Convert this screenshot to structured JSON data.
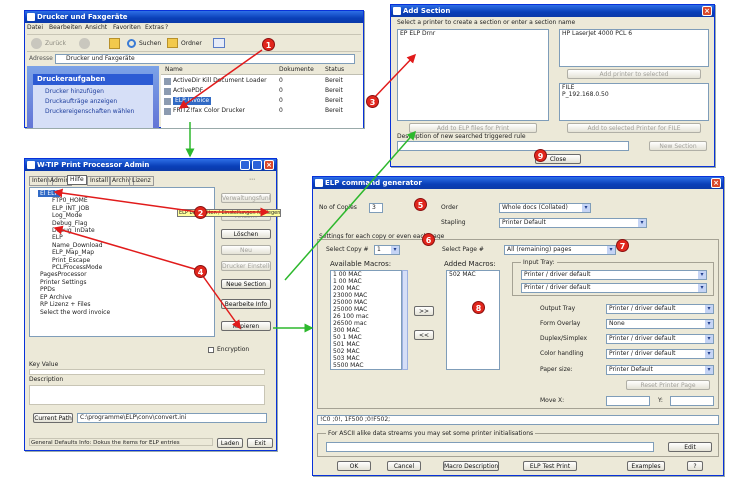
{
  "explorer": {
    "title": "Drucker und Faxgeräte",
    "menu": [
      "Datei",
      "Bearbeiten",
      "Ansicht",
      "Favoriten",
      "Extras",
      "?"
    ],
    "toolbar": {
      "back": "Zurück",
      "search": "Suchen",
      "folders": "Ordner"
    },
    "address_label": "Adresse",
    "address_value": "Drucker und Faxgeräte",
    "tasks_header": "Druckeraufgaben",
    "tasks": [
      "Drucker hinzufügen",
      "Druckaufträge anzeigen",
      "Druckereigenschaften wählen"
    ],
    "columns": [
      "Name",
      "Dokumente",
      "Status"
    ],
    "printers": [
      {
        "name": "ActiveDir Kill Document Loader",
        "docs": "0",
        "status": "Bereit"
      },
      {
        "name": "ActivePDF",
        "docs": "0",
        "status": "Bereit"
      },
      {
        "name": "ELP Invoice",
        "docs": "0",
        "status": "Bereit"
      },
      {
        "name": "FRITZ!fax Color Drucker",
        "docs": "0",
        "status": "Bereit"
      }
    ]
  },
  "admin": {
    "title": "W-TIP Print Processor Admin",
    "tabs": [
      "Intern",
      "Admin",
      "Hilfe",
      "Install",
      "Archiv",
      "Lizenz"
    ],
    "tree": [
      "El ELP",
      "FTP0_HOME",
      "ELP_INT_JOB",
      "Log_Mode",
      "Debug_Flag",
      "Debug_InDate",
      "ELP",
      "Name_Download",
      "ELP_Map_Map",
      "Print_Escape",
      "PCLProcessMode",
      "PagesProcessor",
      "Printer Settings",
      "PPDs",
      "EP Archive",
      "RP Lizenz + Files",
      "Select the word invoice"
    ],
    "tooltip": "ELP bearbeiten / Einstellungen festlegen",
    "right_buttons": [
      "Verwaltungsfunktion",
      "Ändern",
      "Löschen",
      "Neu",
      "Drucker Einstellungen",
      "Neue Section",
      "Bearbeite Info",
      "Kopieren"
    ],
    "checkbox_label": "Encryption",
    "keyvalue_label": "Key Value",
    "desc_label": "Description",
    "path_btn": "Current Path",
    "path_value": "C:\\programme\\ELP\\conv\\convert.ini",
    "status_text": "General Defaults Info: Dokus the items for ELP entries",
    "footer": [
      "Laden",
      "Exit"
    ]
  },
  "addsection": {
    "title": "Add Section",
    "instruction": "Select a printer to create a section or enter a section name",
    "left_item": "EP ELP Drnr",
    "printer_item": "HP LaserJet 4000 PCL 6",
    "add_printer_btn": "Add printer to selected",
    "file_label": "FILE",
    "file_value": "P_192.168.0.50",
    "left_btn": "Add to ELP files for Print",
    "right_btn": "Add to selected Printer for FILE",
    "desc_label": "Description of new searched triggered rule",
    "new_section_btn": "New Section",
    "close_btn": "Close"
  },
  "generator": {
    "title": "ELP command generator",
    "copies_label": "No of Copies",
    "copies_value": "3",
    "order_label": "Order",
    "order_value": "Whole docs (Collated)",
    "stapling_label": "Stapling",
    "stapling_value": "Printer Default",
    "settings_label": "Settings for each copy or even each page",
    "select_copy_label": "Select Copy #",
    "select_copy_value": "1",
    "select_page_label": "Select Page #",
    "select_page_value": "All (remaining) pages",
    "available_label": "Available Macros:",
    "added_label": "Added Macros:",
    "macros": [
      "1 00 MAC",
      "1 00 MAC",
      "200 MAC",
      "23000 MAC",
      "25000 MAC",
      "25000 MAC",
      "26 100 mac",
      "26500 mac",
      "300 MAC",
      "50 1 MAC",
      "501 MAC",
      "502 MAC",
      "503 MAC",
      "5500 MAC",
      "5510 mac"
    ],
    "added": [
      "502 MAC"
    ],
    "move_right": ">>",
    "move_left": "<<",
    "input_tray_label": "Input Tray:",
    "input_tray": [
      "Printer / driver default",
      "Printer / driver default"
    ],
    "output_tray_label": "Output Tray",
    "output_tray_value": "Printer / driver default",
    "form_overlay_label": "Form Overlay",
    "form_overlay_value": "None",
    "duplex_label": "Duplex/Simplex",
    "duplex_value": "Printer / driver default",
    "color_label": "Color handling",
    "color_value": "Printer / driver default",
    "paper_label": "Paper size:",
    "paper_value": "Printer Default",
    "reset_btn": "Reset Printer Page",
    "move_x_label": "Move X:",
    "move_y_label": "Y:",
    "command_value": "!C0 ;0!, 1F500 ;0!F502;",
    "ascii_label": "For ASCII alike data streams you may set some printer initialisations",
    "edit_btn": "Edit",
    "footer": [
      "OK",
      "Cancel",
      "Macro Description",
      "ELP Test Print",
      "Examples",
      "?"
    ]
  },
  "badges": [
    "1",
    "2",
    "3",
    "4",
    "5",
    "6",
    "7",
    "8",
    "9"
  ],
  "colors": {
    "badge_red": "#e1261c",
    "arrow_red": "#e11b1b",
    "arrow_green": "#2db82d",
    "titlebar": "#0a3fb8",
    "selected": "#316ac5"
  }
}
